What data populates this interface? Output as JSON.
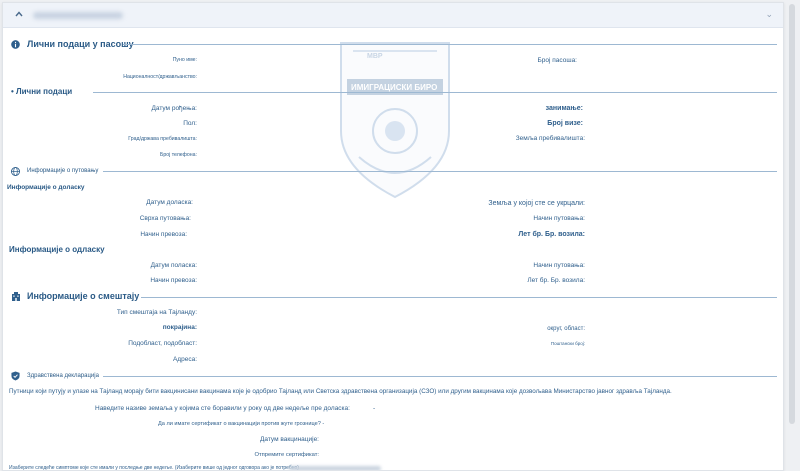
{
  "header": {
    "collapse_icon": "chevron-up-icon",
    "menu_icon": "more-icon",
    "menu_symbol": "⌄"
  },
  "watermark": {
    "top_text": "МВР",
    "main_text": "ИМИГРАЦИСКИ БИРО"
  },
  "passport": {
    "title": "Лични подаци у пасошу",
    "full_name": "Пуно име:",
    "passport_no": "Број пасоша:",
    "nationality": "Националност/држављанство:"
  },
  "personal": {
    "title": "• Лични подаци",
    "birth_date": "Датум рођења:",
    "occupation": "занимање:",
    "sex": "Пол:",
    "visa_no": "Број визе:",
    "city_residence": "Град/држава пребивалишта:",
    "country_residence": "Земља пребивалишта:",
    "phone": "Број телефона:"
  },
  "travel": {
    "title": "Информације о путовању",
    "arrival_title": "Информације о доласку",
    "arrival_date": "Датум доласка:",
    "boarding_country": "Земља у којој сте се укрцали:",
    "purpose": "Сврха путовања:",
    "travel_mode": "Начин путовања:",
    "transport_mode": "Начин превоза:",
    "flight_no": "Лет бр. Бр. возила:",
    "departure_title": "Информације о одласку",
    "departure_date": "Датум поласка:",
    "dep_travel_mode": "Начин путовања:",
    "dep_transport_mode": "Начин превоза:",
    "dep_flight_no": "Лет бр. Бр. возила:"
  },
  "accommodation": {
    "title": "Информације о смештају",
    "type": "Тип смештаја на Тајланду:",
    "province": "покрајина:",
    "district": "округ, област:",
    "subdistrict": "Подобласт, подобласт:",
    "postal": "Поштански број:",
    "address": "Адреса:"
  },
  "health": {
    "title": "Здравствена декларација",
    "notice": "Путници који путују и улазе на Тајланд морају бити вакцинисани вакцинама које је одобрио Тајланд или Светска здравствена организација (СЗО) или другим вакцинама које дозвољава Министарство јавног здравља Тајланда.",
    "countries_q": "Наведите називе земаља у којима сте боравили у року од две недеље пре доласка:",
    "countries_value": "-",
    "certificate_q": "Да ли имате сертификат о вакцинацији против жуте грознице? -",
    "vaccination_date": "Датум вакцинације:",
    "certificate_sent": "Отпремите сертификат:",
    "footer_note": "Изаберите следеће симптоме које сте имали у последње две недеље. (Изаберите више од једног одговора ако је потребно)"
  }
}
